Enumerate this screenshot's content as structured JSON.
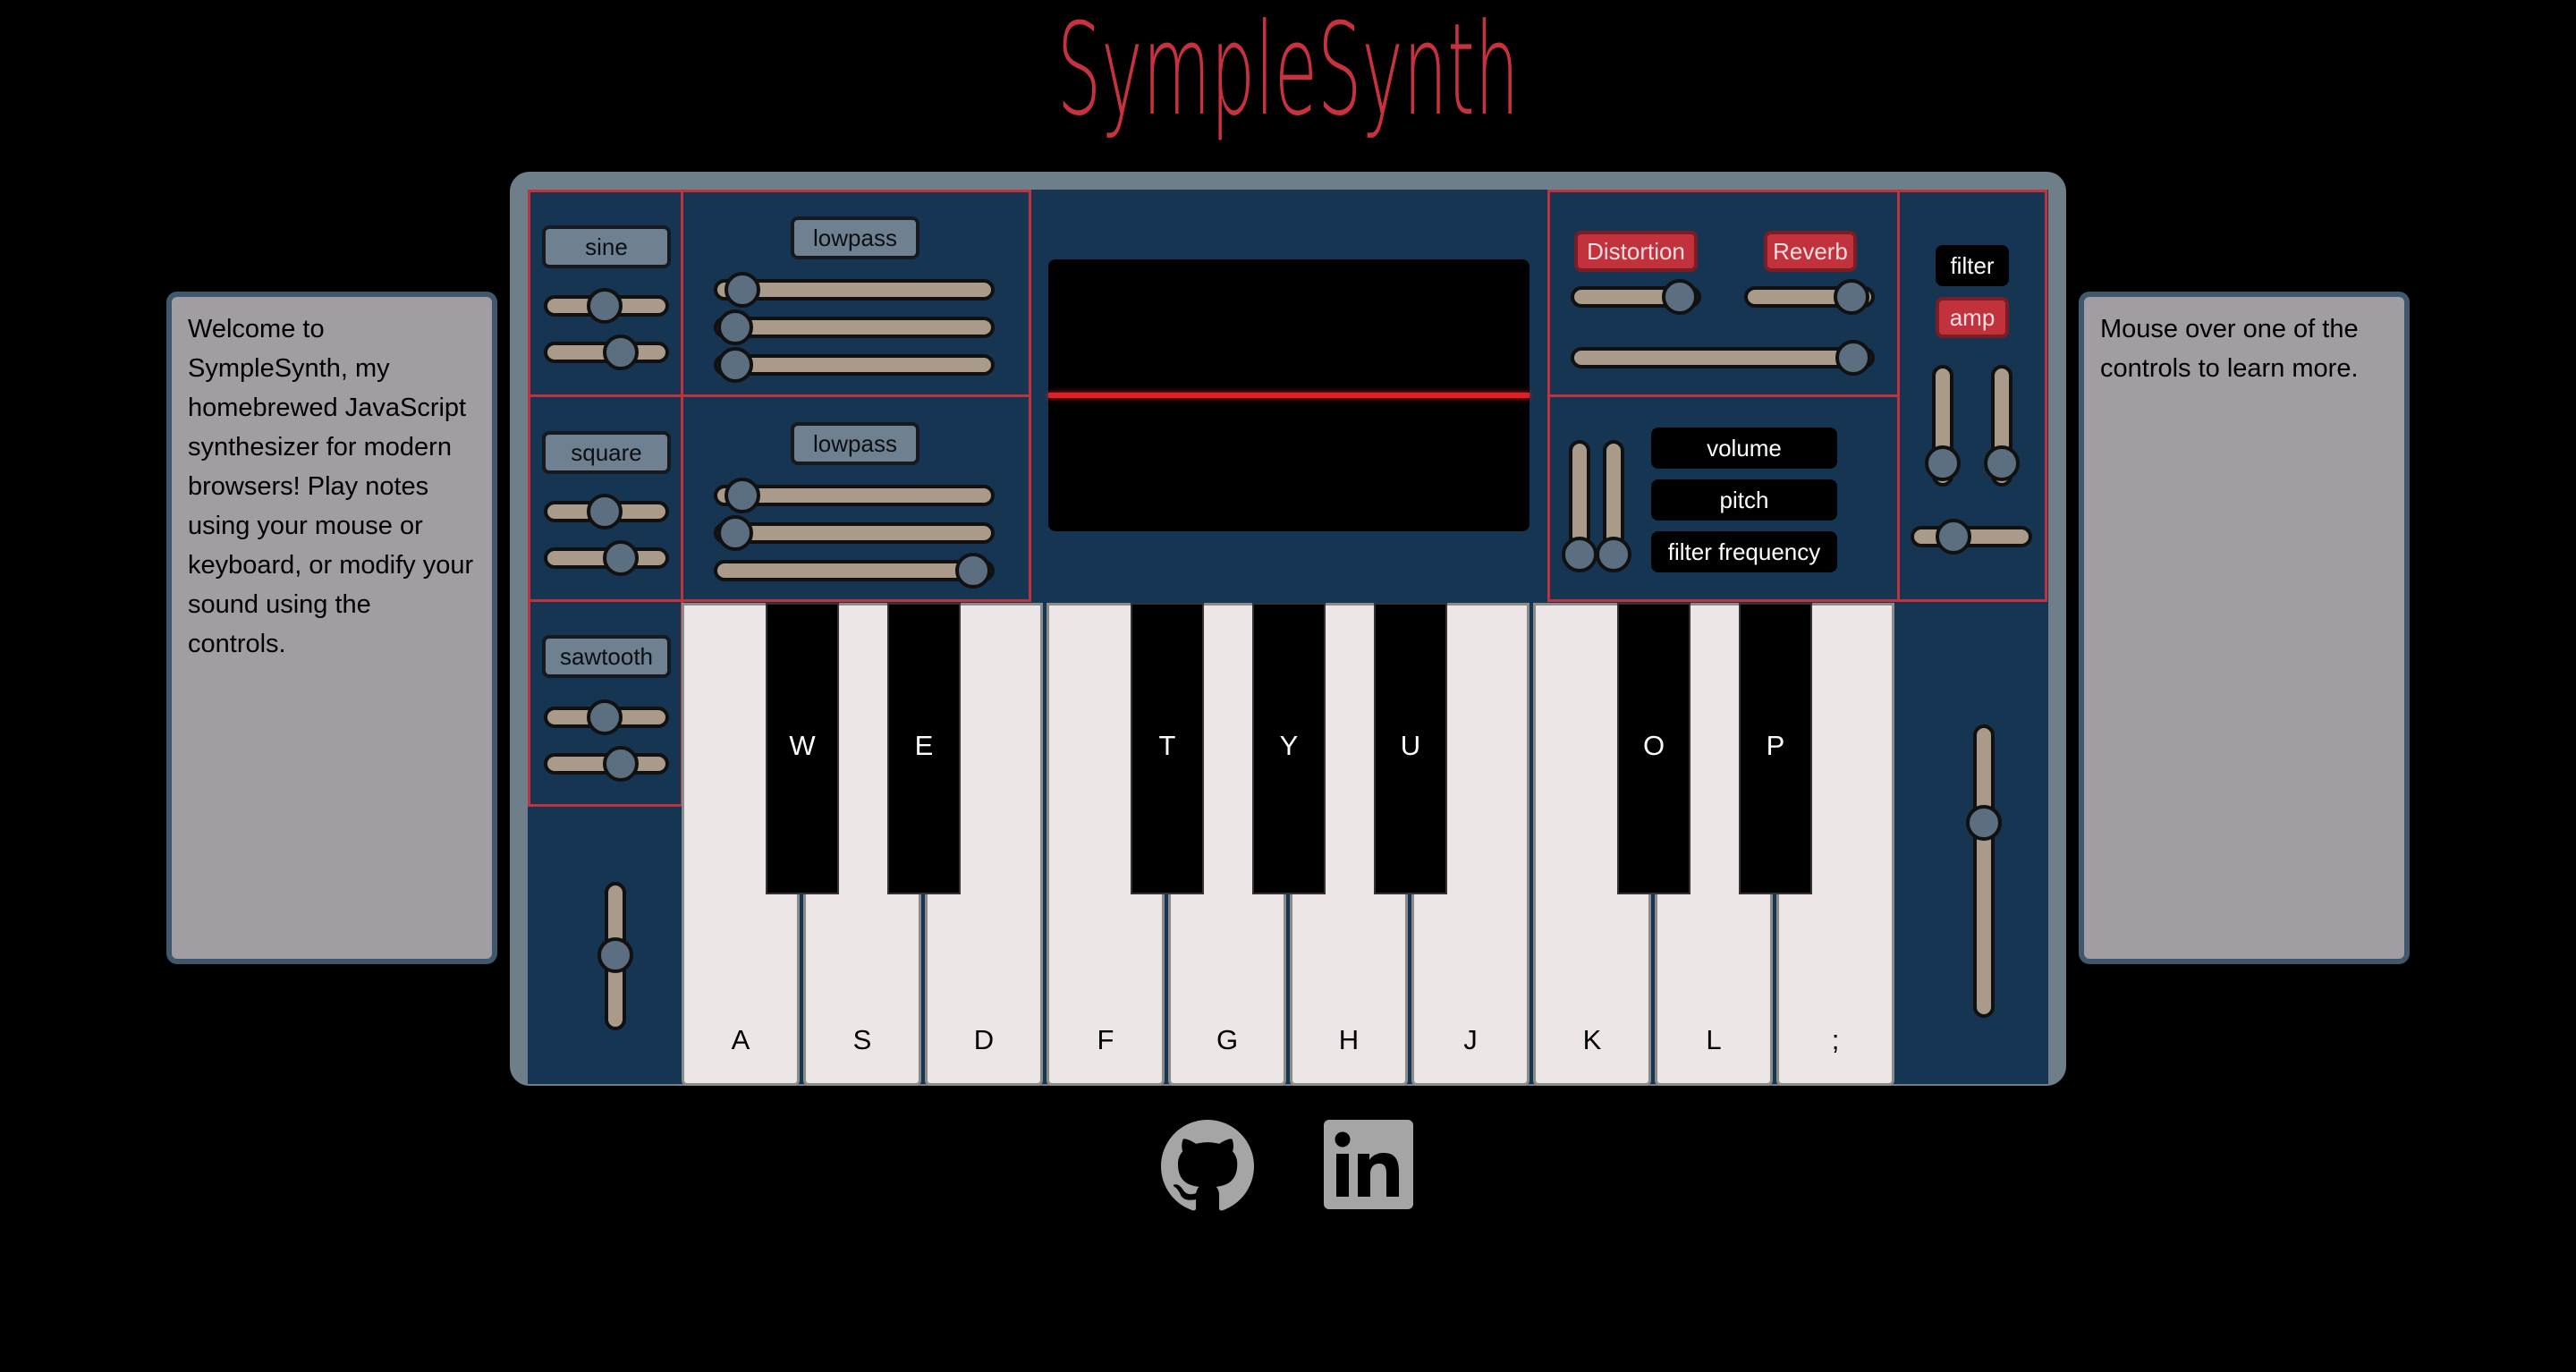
{
  "app": {
    "title": "SympleSynth"
  },
  "info_left": {
    "text": "Welcome to SympleSynth, my homebrewed JavaScript synthesizer for modern browsers! Play notes using your mouse or keyboard, or modify your sound using the controls."
  },
  "info_right": {
    "text": "Mouse over one of the controls to learn more."
  },
  "oscillators": {
    "osc1": {
      "label": "sine"
    },
    "osc2": {
      "label": "square"
    },
    "osc3": {
      "label": "sawtooth"
    }
  },
  "filters": {
    "filter1": {
      "label": "lowpass"
    },
    "filter2": {
      "label": "lowpass"
    }
  },
  "effects": {
    "distortion": {
      "label": "Distortion"
    },
    "reverb": {
      "label": "Reverb"
    }
  },
  "modulation_targets": {
    "volume": "volume",
    "pitch": "pitch",
    "filter_frequency": "filter frequency"
  },
  "envelope": {
    "filter": "filter",
    "amp": "amp"
  },
  "keyboard": {
    "white_keys": [
      "A",
      "S",
      "D",
      "F",
      "G",
      "H",
      "J",
      "K",
      "L",
      ";"
    ],
    "black_keys": [
      "W",
      "E",
      "T",
      "Y",
      "U",
      "O",
      "P"
    ]
  },
  "colors": {
    "accent_red": "#c1323d",
    "panel_blue": "#163552",
    "background": "#000000"
  },
  "icons": {
    "github": "github-icon",
    "linkedin": "linkedin-icon"
  }
}
